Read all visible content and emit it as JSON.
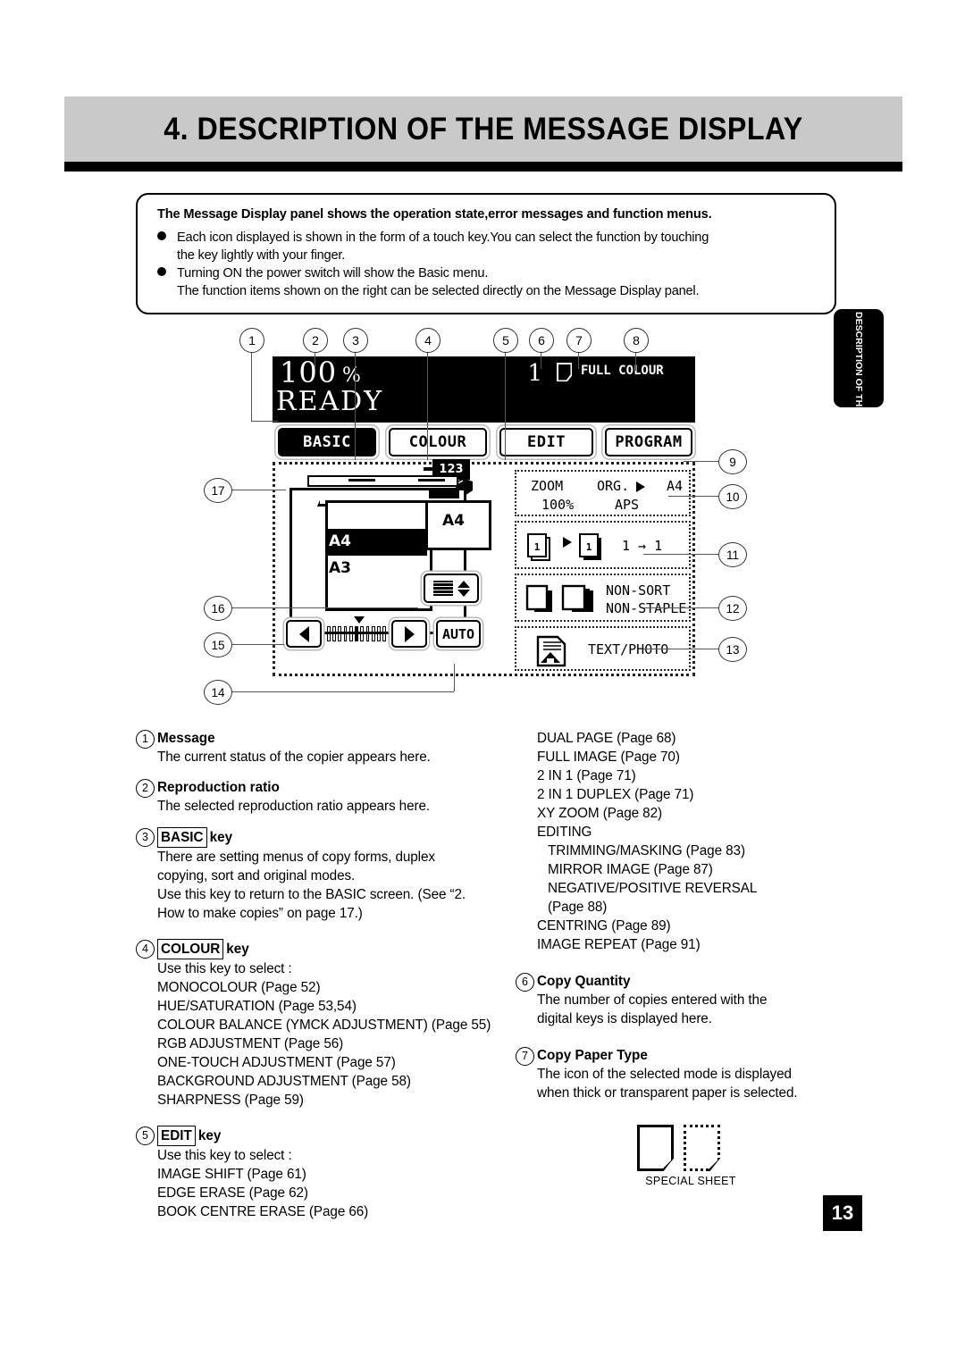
{
  "title": "4. DESCRIPTION OF THE MESSAGE DISPLAY",
  "side_tab": "DESCRIPTION OF THE DIGITAL COPIER",
  "page_number": "13",
  "intro": {
    "headline": "The Message Display panel shows the operation state,error messages and function menus.",
    "bullets": [
      "Each icon displayed is shown in the form of a touch key.You can select the function by touching the key lightly with your finger.",
      "Turning ON the power switch will show the Basic menu. The function items shown on the right can be selected directly on the Message Display panel."
    ],
    "bullet1_line1": "Each icon displayed is shown in the form of a touch key.You can select the function by touching",
    "bullet1_line2": "the key lightly with your finger.",
    "bullet2_line1": "Turning ON the power switch will show the Basic menu.",
    "bullet2_line2": "The function items shown on the right can be selected directly on the Message Display panel."
  },
  "lcd": {
    "ratio": "100",
    "percent": "%",
    "message": "READY",
    "copy_quantity": "1",
    "colour_mode": "FULL COLOUR",
    "paper_badge": "123",
    "tabs": [
      {
        "label": "BASIC",
        "selected": true
      },
      {
        "label": "COLOUR",
        "selected": false
      },
      {
        "label": "EDIT",
        "selected": false
      },
      {
        "label": "PROGRAM",
        "selected": false
      }
    ],
    "drawer": {
      "selected_size": "A4",
      "other_size": "A3",
      "output_size": "A4"
    },
    "density": {
      "auto_label": "AUTO"
    },
    "zoom_key": {
      "zoom_label": "ZOOM",
      "org_label": "ORG.",
      "dest_label": "A4",
      "ratio_value": "100%",
      "aps_label": "APS"
    },
    "duplex_key": {
      "label": "1 → 1"
    },
    "finisher_key": {
      "line1": "NON-SORT",
      "line2": "NON-STAPLE"
    },
    "original_mode_key": {
      "label": "TEXT/PHOTO"
    }
  },
  "callouts": {
    "c1": "1",
    "c2": "2",
    "c3": "3",
    "c4": "4",
    "c5": "5",
    "c6": "6",
    "c7": "7",
    "c8": "8",
    "c9": "9",
    "c10": "10",
    "c11": "11",
    "c12": "12",
    "c13": "13",
    "c14": "14",
    "c15": "15",
    "c16": "16",
    "c17": "17"
  },
  "items": {
    "i1": {
      "num": "1",
      "heading": "Message",
      "lines": [
        "The current status of the copier appears here."
      ]
    },
    "i2": {
      "num": "2",
      "heading": "Reproduction ratio",
      "lines": [
        "The selected reproduction ratio appears here."
      ]
    },
    "i3": {
      "num": "3",
      "key": "BASIC",
      "key_suffix": "key",
      "lines": [
        "There are setting menus of copy forms, duplex",
        "copying, sort and original modes.",
        "Use this key to return to the BASIC screen. (See “2.",
        "How to make copies” on page 17.)"
      ]
    },
    "i4": {
      "num": "4",
      "key": "COLOUR",
      "key_suffix": "key",
      "lines": [
        "Use this key to select :",
        "MONOCOLOUR (Page 52)",
        "HUE/SATURATION (Page 53,54)",
        "COLOUR BALANCE (YMCK ADJUSTMENT) (Page 55)",
        "RGB ADJUSTMENT (Page 56)",
        "ONE-TOUCH ADJUSTMENT (Page 57)",
        "BACKGROUND ADJUSTMENT (Page 58)",
        "SHARPNESS (Page 59)"
      ]
    },
    "i5": {
      "num": "5",
      "key": "EDIT",
      "key_suffix": "key",
      "lines": [
        "Use this key to select :",
        "IMAGE SHIFT (Page 61)",
        "EDGE ERASE (Page 62)",
        "BOOK CENTRE ERASE (Page 66)"
      ]
    },
    "i5_cont": {
      "lines": [
        "DUAL PAGE (Page 68)",
        "FULL IMAGE (Page 70)",
        "2 IN 1 (Page 71)",
        "2 IN 1 DUPLEX (Page 71)",
        "XY ZOOM (Page 82)",
        "EDITING"
      ],
      "sub_lines": [
        "TRIMMING/MASKING (Page 83)",
        "MIRROR IMAGE (Page 87)",
        "NEGATIVE/POSITIVE REVERSAL",
        "(Page 88)"
      ],
      "tail_lines": [
        "CENTRING (Page 89)",
        "IMAGE REPEAT (Page 91)"
      ]
    },
    "i6": {
      "num": "6",
      "heading": "Copy Quantity",
      "lines": [
        "The number of copies entered with the",
        "digital keys is displayed here."
      ]
    },
    "i7": {
      "num": "7",
      "heading": "Copy Paper Type",
      "lines": [
        "The icon of the selected mode is displayed",
        "when thick or transparent paper is selected."
      ]
    }
  },
  "special_sheet_caption": "SPECIAL SHEET"
}
